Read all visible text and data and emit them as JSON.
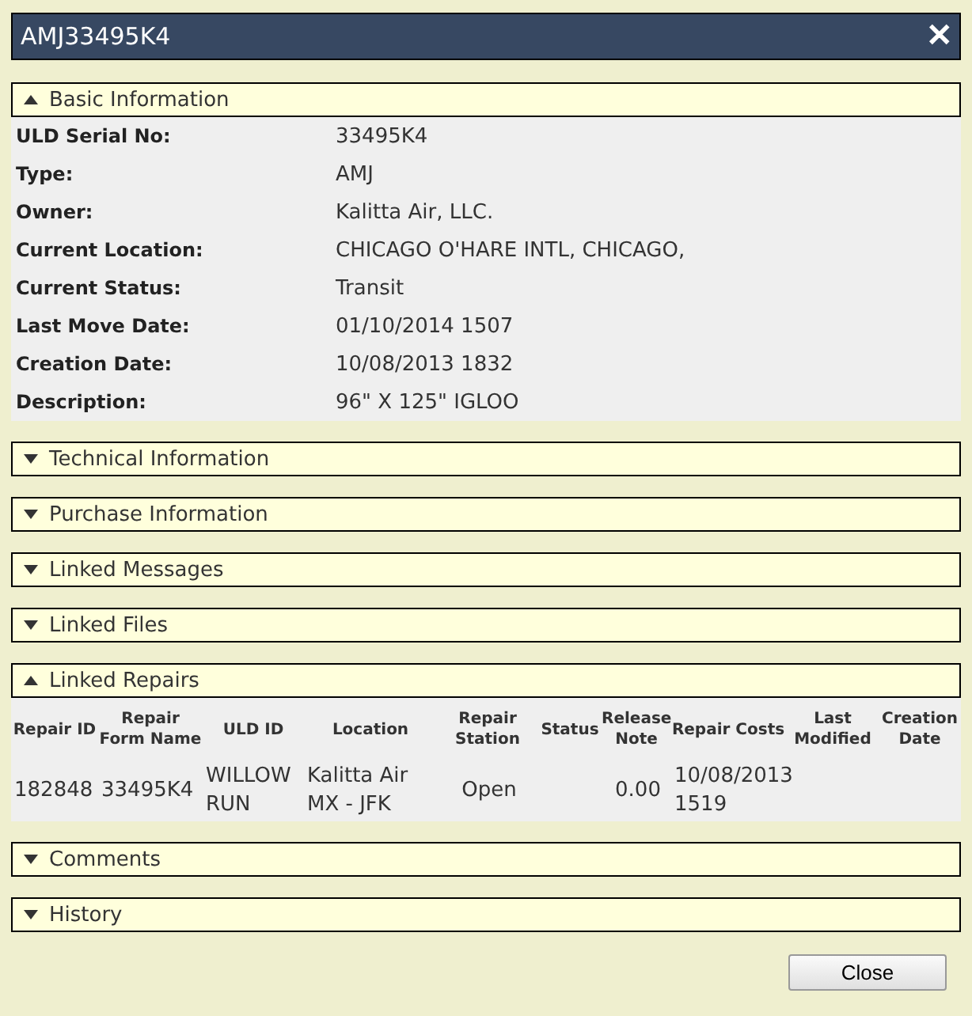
{
  "window": {
    "title": "AMJ33495K4",
    "close_glyph": "✕"
  },
  "sections": [
    {
      "title": "Basic Information",
      "expanded": true,
      "kind": "fields",
      "fields": [
        {
          "label": "ULD Serial No:",
          "value": "33495K4"
        },
        {
          "label": "Type:",
          "value": "AMJ"
        },
        {
          "label": "Owner:",
          "value": "Kalitta Air, LLC."
        },
        {
          "label": "Current Location:",
          "value": "CHICAGO O'HARE INTL, CHICAGO,"
        },
        {
          "label": "Current Status:",
          "value": "Transit"
        },
        {
          "label": "Last Move Date:",
          "value": "01/10/2014 1507"
        },
        {
          "label": "Creation Date:",
          "value": "10/08/2013 1832"
        },
        {
          "label": "Description:",
          "value": "96\" X 125\" IGLOO"
        }
      ]
    },
    {
      "title": "Technical Information",
      "expanded": false
    },
    {
      "title": "Purchase Information",
      "expanded": false
    },
    {
      "title": "Linked Messages",
      "expanded": false
    },
    {
      "title": "Linked Files",
      "expanded": false
    },
    {
      "title": "Linked Repairs",
      "expanded": true,
      "kind": "table",
      "columns": [
        "Repair ID",
        "Repair Form Name",
        "ULD ID",
        "Location",
        "Repair Station",
        "Status",
        "Release Note",
        "Repair Costs",
        "Last Modified",
        "Creation Date"
      ],
      "rows": [
        [
          "182848",
          "33495K4",
          "WILLOW RUN",
          "Kalitta Air MX - JFK",
          "Open",
          null,
          "0.00",
          "10/08/2013 1519",
          null,
          null
        ]
      ]
    },
    {
      "title": "Comments",
      "expanded": false
    },
    {
      "title": "History",
      "expanded": false
    }
  ],
  "buttons": [
    {
      "label": "Close"
    }
  ]
}
